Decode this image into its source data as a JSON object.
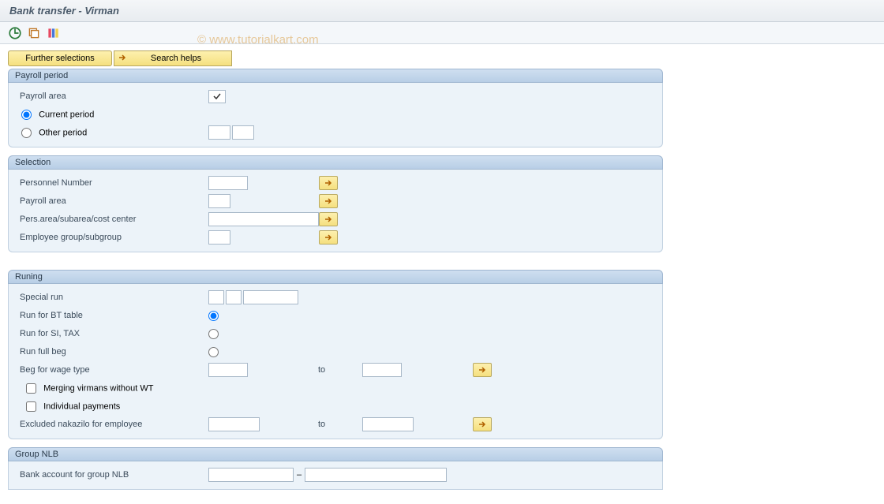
{
  "header": {
    "title": "Bank transfer - Virman"
  },
  "watermark": "© www.tutorialkart.com",
  "topButtons": {
    "further": "Further selections",
    "searchHelps": "Search helps"
  },
  "payrollPeriod": {
    "title": "Payroll period",
    "area_label": "Payroll area",
    "area_value": "☑",
    "current_label": "Current period",
    "other_label": "Other period"
  },
  "selection": {
    "title": "Selection",
    "pernr_label": "Personnel Number",
    "parea_label": "Payroll area",
    "pers_area_label": "Pers.area/subarea/cost center",
    "emp_group_label": "Employee group/subgroup"
  },
  "running": {
    "title": "Runing",
    "special_label": "Special run",
    "run_bt_label": "Run for BT table",
    "run_si_label": "Run  for  SI, TAX",
    "run_full_label": "Run full beg",
    "beg_wage_label": "Beg for wage type",
    "to_label": "to",
    "merge_label": "Merging virmans without WT",
    "indiv_label": "Individual payments",
    "excl_label": "Excluded nakazilo for employee"
  },
  "groupNLB": {
    "title": "Group NLB",
    "bank_label": "Bank account for group NLB"
  }
}
